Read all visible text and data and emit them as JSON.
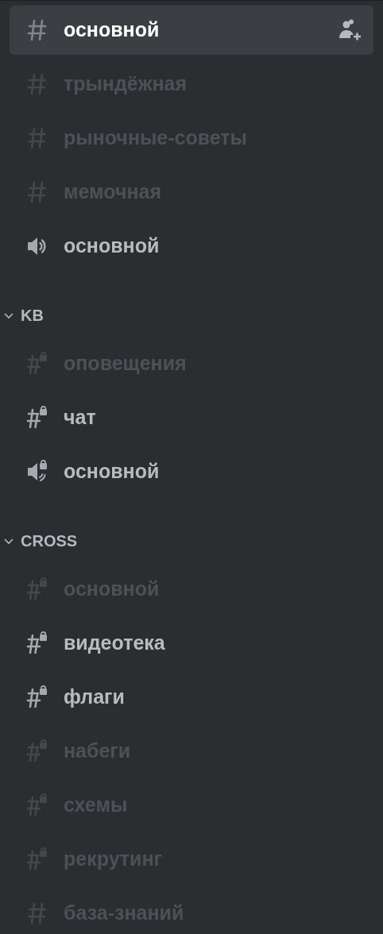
{
  "channels": [
    {
      "name": "основной",
      "kind": "text",
      "selected": true,
      "unread": true
    },
    {
      "name": "трындёжная",
      "kind": "text",
      "selected": false,
      "unread": false
    },
    {
      "name": "рыночные-советы",
      "kind": "text",
      "selected": false,
      "unread": false
    },
    {
      "name": "мемочная",
      "kind": "text",
      "selected": false,
      "unread": false
    },
    {
      "name": "основной",
      "kind": "voice",
      "selected": false,
      "unread": true
    }
  ],
  "categories": [
    {
      "name": "KB",
      "expanded": true,
      "channels": [
        {
          "name": "оповещения",
          "kind": "locked-text",
          "selected": false,
          "unread": false
        },
        {
          "name": "чат",
          "kind": "locked-text",
          "selected": false,
          "unread": true
        },
        {
          "name": "основной",
          "kind": "locked-voice",
          "selected": false,
          "unread": true
        }
      ]
    },
    {
      "name": "CROSS",
      "expanded": true,
      "channels": [
        {
          "name": "основной",
          "kind": "locked-text",
          "selected": false,
          "unread": false
        },
        {
          "name": "видеотека",
          "kind": "locked-text",
          "selected": false,
          "unread": true
        },
        {
          "name": "флаги",
          "kind": "locked-text",
          "selected": false,
          "unread": true
        },
        {
          "name": "набеги",
          "kind": "locked-text",
          "selected": false,
          "unread": false
        },
        {
          "name": "схемы",
          "kind": "locked-text",
          "selected": false,
          "unread": false
        },
        {
          "name": "рекрутинг",
          "kind": "locked-text",
          "selected": false,
          "unread": false
        },
        {
          "name": "база-знаний",
          "kind": "text",
          "selected": false,
          "unread": false
        }
      ]
    }
  ]
}
